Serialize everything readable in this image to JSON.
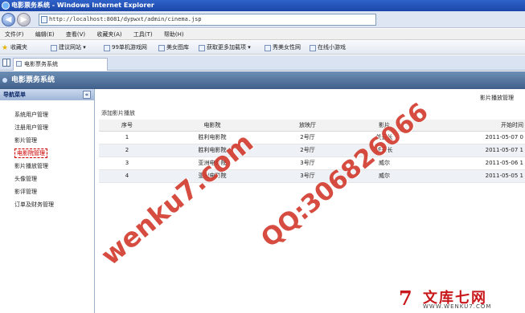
{
  "window": {
    "title": "电影票务系统 - Windows Internet Explorer"
  },
  "address": {
    "url": "http://localhost:8081/dypwxt/admin/cinema.jsp"
  },
  "menu": [
    "文件(F)",
    "编辑(E)",
    "查看(V)",
    "收藏夹(A)",
    "工具(T)",
    "帮助(H)"
  ],
  "favorites": {
    "label": "收藏夹",
    "items": [
      "建议网站 ▾",
      "99单机游戏网",
      "美女图库",
      "获取更多加载项 ▾",
      "秀美女性网",
      "在线小游戏"
    ]
  },
  "tab": {
    "label": "电影票务系统"
  },
  "app": {
    "title": "电影票务系统"
  },
  "sidebar": {
    "title": "导航菜单",
    "collapse": "«",
    "items": [
      {
        "label": "系统用户管理"
      },
      {
        "label": "注册用户管理"
      },
      {
        "label": "影片管理"
      },
      {
        "label": "电影院管理"
      },
      {
        "label": "影片播放管理"
      },
      {
        "label": "头像管理"
      },
      {
        "label": "影评管理"
      },
      {
        "label": "订单及财务管理"
      }
    ]
  },
  "main": {
    "title": "影片播放管理",
    "add_label": "添加影片播放",
    "columns": [
      "序号",
      "电影院",
      "放映厅",
      "影片",
      "开始时间"
    ],
    "rows": [
      [
        "1",
        "胜利电影院",
        "2号厅",
        "关云长",
        "2011-05-07 0"
      ],
      [
        "2",
        "胜利电影院",
        "2号厅",
        "关云长",
        "2011-05-07 1"
      ],
      [
        "3",
        "亚洲电影院",
        "3号厅",
        "威尔",
        "2011-05-06 1"
      ],
      [
        "4",
        "亚洲电影院",
        "3号厅",
        "威尔",
        "2011-05-05 1"
      ]
    ]
  },
  "watermarks": {
    "site": "wenku7.com",
    "qq": "QQ:306826066"
  },
  "logo": {
    "mark": "7",
    "name": "文库七网",
    "url": "WWW.WENKU7.COM"
  }
}
